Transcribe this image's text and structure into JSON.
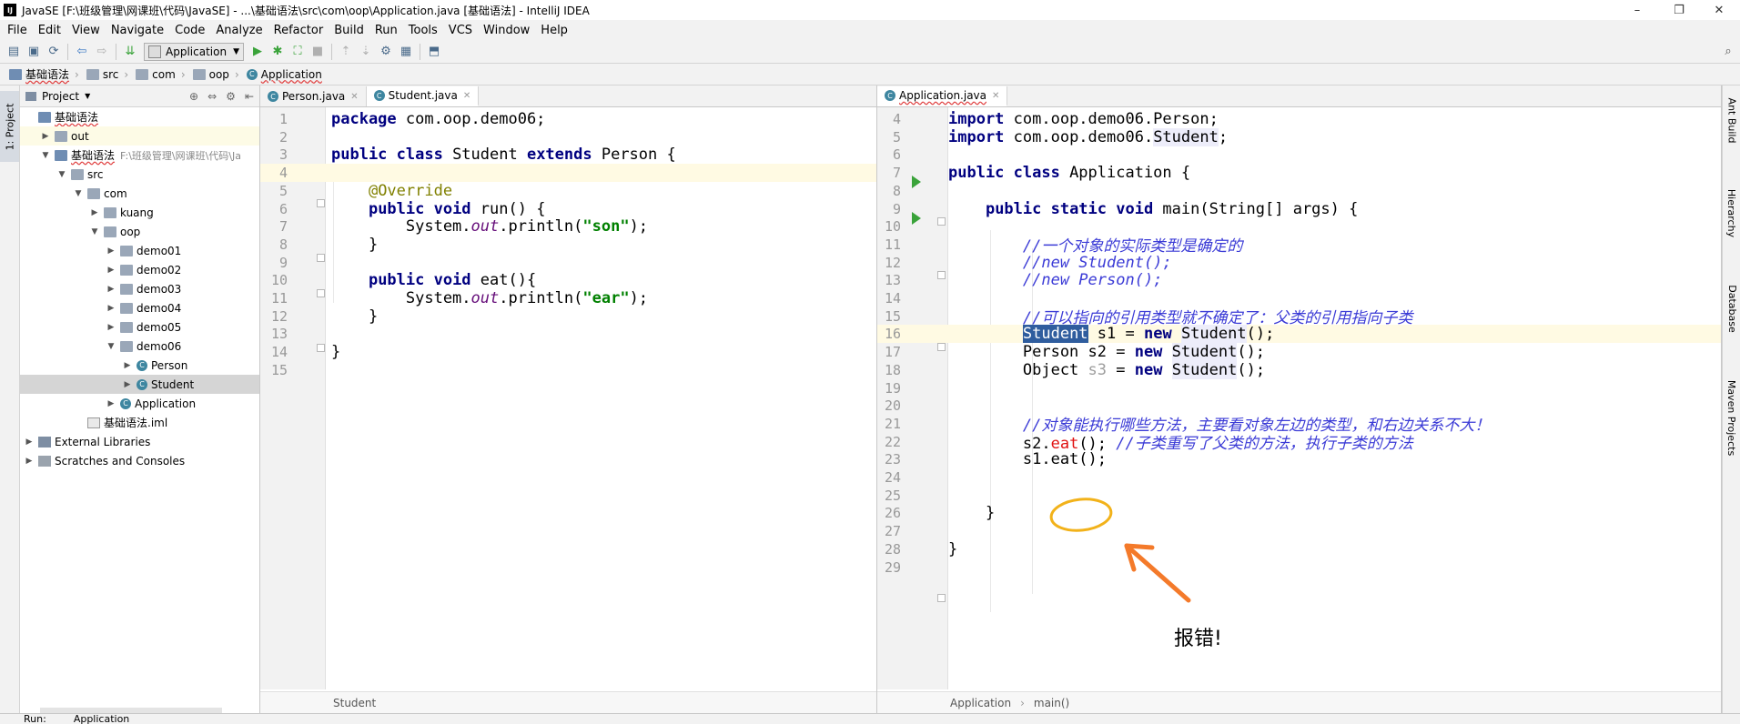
{
  "window": {
    "title": "JavaSE [F:\\班级管理\\网课班\\代码\\JavaSE] - ...\\基础语法\\src\\com\\oop\\Application.java [基础语法] - IntelliJ IDEA",
    "controls": {
      "minimize": "–",
      "maximize": "❐",
      "close": "✕"
    }
  },
  "menu": [
    "File",
    "Edit",
    "View",
    "Navigate",
    "Code",
    "Analyze",
    "Refactor",
    "Build",
    "Run",
    "Tools",
    "VCS",
    "Window",
    "Help"
  ],
  "toolbar": {
    "run_config": "Application"
  },
  "breadcrumb": [
    "基础语法",
    "src",
    "com",
    "oop",
    "Application"
  ],
  "left_strip": {
    "project_tab": "1: Project"
  },
  "right_strip": [
    "Ant Build",
    "Hierarchy",
    "Database",
    "Maven Projects"
  ],
  "project": {
    "title": "Project",
    "tree": [
      {
        "label": "基础语法",
        "level": 0,
        "arrow": "",
        "icon": "module"
      },
      {
        "label": "out",
        "level": 1,
        "arrow": "▶",
        "icon": "folder",
        "hl": true
      },
      {
        "label": "基础语法",
        "sub": "F:\\班级管理\\网课班\\代码\\Ja",
        "level": 1,
        "arrow": "▼",
        "icon": "module"
      },
      {
        "label": "src",
        "level": 2,
        "arrow": "▼",
        "icon": "folder"
      },
      {
        "label": "com",
        "level": 3,
        "arrow": "▼",
        "icon": "folder"
      },
      {
        "label": "kuang",
        "level": 4,
        "arrow": "▶",
        "icon": "folder"
      },
      {
        "label": "oop",
        "level": 4,
        "arrow": "▼",
        "icon": "folder"
      },
      {
        "label": "demo01",
        "level": 5,
        "arrow": "▶",
        "icon": "folder"
      },
      {
        "label": "demo02",
        "level": 5,
        "arrow": "▶",
        "icon": "folder"
      },
      {
        "label": "demo03",
        "level": 5,
        "arrow": "▶",
        "icon": "folder"
      },
      {
        "label": "demo04",
        "level": 5,
        "arrow": "▶",
        "icon": "folder"
      },
      {
        "label": "demo05",
        "level": 5,
        "arrow": "▶",
        "icon": "folder"
      },
      {
        "label": "demo06",
        "level": 5,
        "arrow": "▼",
        "icon": "folder"
      },
      {
        "label": "Person",
        "level": 6,
        "arrow": "▶",
        "icon": "class"
      },
      {
        "label": "Student",
        "level": 6,
        "arrow": "▶",
        "icon": "class",
        "selected": true
      },
      {
        "label": "Application",
        "level": 5,
        "arrow": "▶",
        "icon": "class"
      },
      {
        "label": "基础语法.iml",
        "level": 3,
        "arrow": "",
        "icon": "file"
      },
      {
        "label": "External Libraries",
        "level": 0,
        "arrow": "▶",
        "icon": "lib"
      },
      {
        "label": "Scratches and Consoles",
        "level": 0,
        "arrow": "▶",
        "icon": "cons"
      }
    ]
  },
  "editor_left": {
    "tabs": [
      {
        "label": "Person.java",
        "active": false
      },
      {
        "label": "Student.java",
        "active": true
      }
    ],
    "current_line": 4,
    "lines": [
      {
        "n": "1",
        "html": "<span class=\"kw\">package</span> com.oop.demo06;"
      },
      {
        "n": "2",
        "html": ""
      },
      {
        "n": "3",
        "html": "<span class=\"kw\">public class</span> Student <span class=\"kw\">extends</span> Person {"
      },
      {
        "n": "4",
        "html": ""
      },
      {
        "n": "5",
        "html": "    <span class=\"ann\">@Override</span>"
      },
      {
        "n": "6",
        "html": "    <span class=\"kw\">public void</span> run() {"
      },
      {
        "n": "7",
        "html": "        System.<span class=\"fld\">out</span>.println(<span class=\"str\">\"son\"</span>);"
      },
      {
        "n": "8",
        "html": "    }"
      },
      {
        "n": "9",
        "html": ""
      },
      {
        "n": "10",
        "html": "    <span class=\"kw\">public void</span> eat(){"
      },
      {
        "n": "11",
        "html": "        System.<span class=\"fld\">out</span>.println(<span class=\"str\">\"ear\"</span>);"
      },
      {
        "n": "12",
        "html": "    }"
      },
      {
        "n": "13",
        "html": ""
      },
      {
        "n": "14",
        "html": "}"
      },
      {
        "n": "15",
        "html": ""
      }
    ],
    "footer": "Student"
  },
  "editor_right": {
    "tabs": [
      {
        "label": "Application.java",
        "active": true
      }
    ],
    "current_line": 16,
    "lines": [
      {
        "n": "4",
        "html": "<span class=\"kw\">import</span> com.oop.demo06.Person;"
      },
      {
        "n": "5",
        "html": "<span class=\"kw\">import</span> com.oop.demo06.<span class=\"usage\">Student</span>;"
      },
      {
        "n": "6",
        "html": ""
      },
      {
        "n": "7",
        "html": "<span class=\"kw\">public class</span> Application {"
      },
      {
        "n": "8",
        "html": ""
      },
      {
        "n": "9",
        "html": "    <span class=\"kw\">public static void</span> main(String[] args) {"
      },
      {
        "n": "10",
        "html": ""
      },
      {
        "n": "11",
        "html": "        <span class=\"cmt\">//一个对象的实际类型是确定的</span>"
      },
      {
        "n": "12",
        "html": "        <span class=\"cmt\">//new Student();</span>"
      },
      {
        "n": "13",
        "html": "        <span class=\"cmt\">//new Person();</span>"
      },
      {
        "n": "14",
        "html": ""
      },
      {
        "n": "15",
        "html": "        <span class=\"cmt\">//可以指向的引用类型就不确定了：父类的引用指向子类</span>"
      },
      {
        "n": "16",
        "html": "        <span class=\"sel\">Student</span> s1 = <span class=\"kw\">new</span> <span class=\"usage\">Student</span>();"
      },
      {
        "n": "17",
        "html": "        Person s2 = <span class=\"kw\">new</span> <span class=\"usage\">Student</span>();"
      },
      {
        "n": "18",
        "html": "        Object <span class=\"gray\">s3</span> = <span class=\"kw\">new</span> <span class=\"usage\">Student</span>();"
      },
      {
        "n": "19",
        "html": ""
      },
      {
        "n": "20",
        "html": ""
      },
      {
        "n": "21",
        "html": "        <span class=\"cmt\">//对象能执行哪些方法，主要看对象左边的类型，和右边关系不大！</span>"
      },
      {
        "n": "22",
        "html": "        s2.<span class=\"errtxt\">eat</span>(); <span class=\"cmt\">//子类重写了父类的方法，执行子类的方法</span>"
      },
      {
        "n": "23",
        "html": "        s1.eat();"
      },
      {
        "n": "24",
        "html": ""
      },
      {
        "n": "25",
        "html": ""
      },
      {
        "n": "26",
        "html": "    }"
      },
      {
        "n": "27",
        "html": ""
      },
      {
        "n": "28",
        "html": "}"
      },
      {
        "n": "29",
        "html": ""
      }
    ],
    "footer": [
      "Application",
      "main()"
    ]
  },
  "annotation": {
    "text": "报错!"
  },
  "bottom": {
    "run_label": "Run:",
    "run_tab": "Application"
  }
}
